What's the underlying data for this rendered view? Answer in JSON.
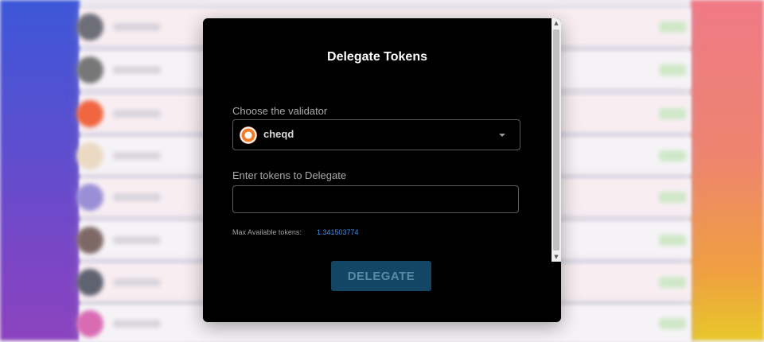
{
  "modal": {
    "title": "Delegate Tokens",
    "validator_label": "Choose the validator",
    "selected_validator": "cheqd",
    "tokens_label": "Enter tokens to Delegate",
    "tokens_value": "",
    "max_label": "Max Available tokens:",
    "max_value": "1.341503774",
    "delegate_button": "DELEGATE"
  },
  "icons": {
    "validator_logo": "cheqd-logo-icon",
    "dropdown": "chevron-down-icon",
    "scroll_up": "scroll-up-arrow-icon",
    "scroll_down": "scroll-down-arrow-icon"
  },
  "colors": {
    "modal_background": "#000000",
    "link_blue": "#3d8ee8",
    "button_background": "#134564",
    "button_text": "#5b8aa6"
  }
}
